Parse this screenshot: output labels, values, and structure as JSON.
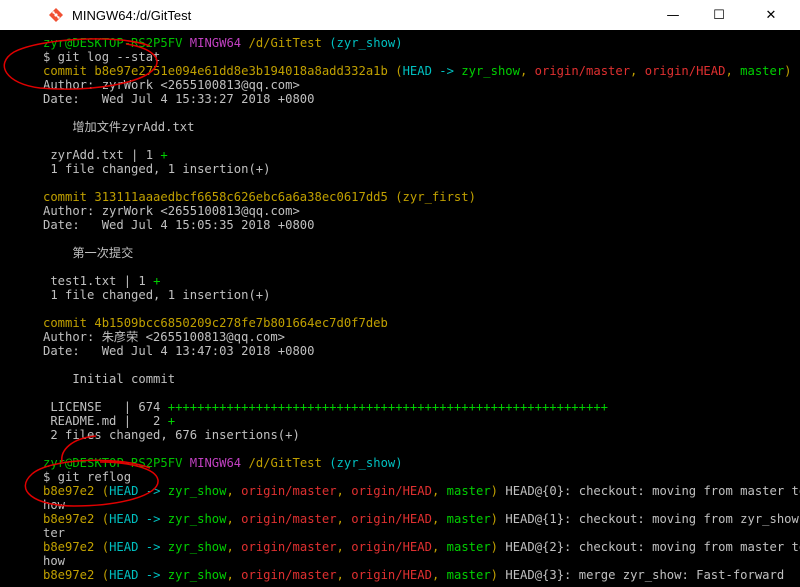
{
  "window": {
    "title": "MINGW64:/d/GitTest",
    "minimize_glyph": "—",
    "maximize_glyph": "☐",
    "close_glyph": "✕"
  },
  "prompt1": {
    "user": "zyr@DESKTOP-RS2P5FV",
    "env": "MINGW64",
    "path": "/d/GitTest",
    "branch": "(zyr_show)"
  },
  "cmd1": "$ git log --stat",
  "commit1": {
    "hash_line": "commit b8e97e2751e094e61dd8e3b194018a8add332a1b",
    "open": "(",
    "head": "HEAD -> ",
    "head_branch": "zyr_show",
    "sep1": ", ",
    "origin_master": "origin/master",
    "sep2": ", ",
    "origin_head": "origin/HEAD",
    "sep3": ", ",
    "master": "master",
    "close": ")",
    "author": "Author: zyrWork <2655100813@qq.com>",
    "date": "Date:   Wed Jul 4 15:33:27 2018 +0800",
    "message": "    增加文件zyrAdd.txt",
    "stat_file": " zyrAdd.txt | 1 ",
    "stat_plus": "+",
    "summary": " 1 file changed, 1 insertion(+)"
  },
  "commit2": {
    "hash_line": "commit 313111aaaedbcf6658c626ebc6a6a38ec0617dd5",
    "branch": "(zyr_first)",
    "author": "Author: zyrWork <2655100813@qq.com>",
    "date": "Date:   Wed Jul 4 15:05:35 2018 +0800",
    "message": "    第一次提交",
    "stat_file": " test1.txt | 1 ",
    "stat_plus": "+",
    "summary": " 1 file changed, 1 insertion(+)"
  },
  "commit3": {
    "hash_line": "commit 4b1509bcc6850209c278fe7b801664ec7d0f7deb",
    "author": "Author: 朱彦荣 <2655100813@qq.com>",
    "date": "Date:   Wed Jul 4 13:47:03 2018 +0800",
    "message": "    Initial commit",
    "stat1_file": " LICENSE   | 674 ",
    "stat1_plus": "++++++++++++++++++++++++++++++++++++++++++++++++++++++++++++",
    "stat2_file": " README.md |   2 ",
    "stat2_plus": "+",
    "summary": " 2 files changed, 676 insertions(+)"
  },
  "prompt2": {
    "user": "zyr@DESKTOP-RS2P5FV",
    "env": "MINGW64",
    "path": "/d/GitTest",
    "branch": "(zyr_show)"
  },
  "cmd2": "$ git reflog",
  "reflog": [
    {
      "hash": "b8e97e2",
      "rest": " HEAD@{0}: checkout: moving from master to zyr_s",
      "wrap": "how"
    },
    {
      "hash": "b8e97e2",
      "rest": " HEAD@{1}: checkout: moving from zyr_show to mas",
      "wrap": "ter"
    },
    {
      "hash": "b8e97e2",
      "rest": " HEAD@{2}: checkout: moving from master to zyr_s",
      "wrap": "how"
    },
    {
      "hash": "b8e97e2",
      "rest": " HEAD@{3}: merge zyr_show: Fast-forward",
      "wrap": ""
    }
  ],
  "reflog_refs": {
    "open": " (",
    "head": "HEAD -> ",
    "head_branch": "zyr_show",
    "sep": ", ",
    "origin_master": "origin/master",
    "origin_head": "origin/HEAD",
    "master": "master",
    "close": ")"
  },
  "colors": {
    "background": "#000000",
    "green": "#00c000",
    "magenta": "#c040c0",
    "yellow": "#c0a000",
    "cyan": "#00c0c0",
    "red": "#e03030",
    "annotation": "#e00000"
  },
  "icons": {
    "app": "git-diamond-icon"
  }
}
